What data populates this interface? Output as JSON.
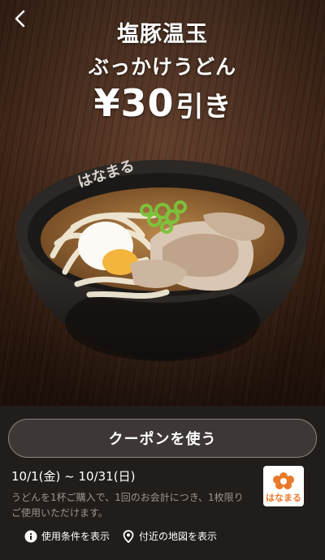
{
  "header": {
    "back_icon": "chevron-left-icon"
  },
  "coupon": {
    "title_line1": "塩豚温玉",
    "title_line2": "ぶっかけうどん",
    "discount_amount": "¥30",
    "discount_suffix": "引き",
    "brand_mark_on_bowl": "はなまる"
  },
  "actions": {
    "use_button_label": "クーポンを使う",
    "terms_link_label": "使用条件を表示",
    "terms_icon": "info-icon",
    "map_link_label": "付近の地図を表示",
    "map_icon": "location-pin-icon"
  },
  "details": {
    "validity": "10/1(金) ~ 10/31(日)",
    "description": "うどんを1杯ご購入で、1回のお会計につき、1枚限りご使用いただけます。"
  },
  "brand": {
    "logo_text": "はなまる",
    "logo_color": "#e8782a"
  },
  "colors": {
    "panel_bg": "#211d1b",
    "button_bg": "#3d3836",
    "button_border": "#8c8580",
    "muted_text": "#9c948f"
  }
}
